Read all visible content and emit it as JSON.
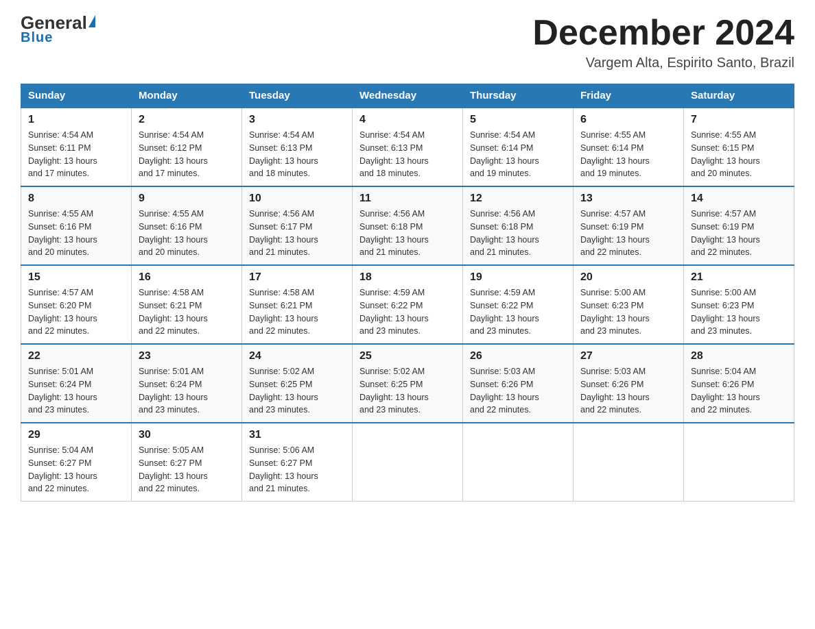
{
  "header": {
    "logo_general": "General",
    "logo_blue": "Blue",
    "month_title": "December 2024",
    "subtitle": "Vargem Alta, Espirito Santo, Brazil"
  },
  "days_of_week": [
    "Sunday",
    "Monday",
    "Tuesday",
    "Wednesday",
    "Thursday",
    "Friday",
    "Saturday"
  ],
  "weeks": [
    [
      {
        "day": "1",
        "sunrise": "4:54 AM",
        "sunset": "6:11 PM",
        "daylight": "13 hours and 17 minutes."
      },
      {
        "day": "2",
        "sunrise": "4:54 AM",
        "sunset": "6:12 PM",
        "daylight": "13 hours and 17 minutes."
      },
      {
        "day": "3",
        "sunrise": "4:54 AM",
        "sunset": "6:13 PM",
        "daylight": "13 hours and 18 minutes."
      },
      {
        "day": "4",
        "sunrise": "4:54 AM",
        "sunset": "6:13 PM",
        "daylight": "13 hours and 18 minutes."
      },
      {
        "day": "5",
        "sunrise": "4:54 AM",
        "sunset": "6:14 PM",
        "daylight": "13 hours and 19 minutes."
      },
      {
        "day": "6",
        "sunrise": "4:55 AM",
        "sunset": "6:14 PM",
        "daylight": "13 hours and 19 minutes."
      },
      {
        "day": "7",
        "sunrise": "4:55 AM",
        "sunset": "6:15 PM",
        "daylight": "13 hours and 20 minutes."
      }
    ],
    [
      {
        "day": "8",
        "sunrise": "4:55 AM",
        "sunset": "6:16 PM",
        "daylight": "13 hours and 20 minutes."
      },
      {
        "day": "9",
        "sunrise": "4:55 AM",
        "sunset": "6:16 PM",
        "daylight": "13 hours and 20 minutes."
      },
      {
        "day": "10",
        "sunrise": "4:56 AM",
        "sunset": "6:17 PM",
        "daylight": "13 hours and 21 minutes."
      },
      {
        "day": "11",
        "sunrise": "4:56 AM",
        "sunset": "6:18 PM",
        "daylight": "13 hours and 21 minutes."
      },
      {
        "day": "12",
        "sunrise": "4:56 AM",
        "sunset": "6:18 PM",
        "daylight": "13 hours and 21 minutes."
      },
      {
        "day": "13",
        "sunrise": "4:57 AM",
        "sunset": "6:19 PM",
        "daylight": "13 hours and 22 minutes."
      },
      {
        "day": "14",
        "sunrise": "4:57 AM",
        "sunset": "6:19 PM",
        "daylight": "13 hours and 22 minutes."
      }
    ],
    [
      {
        "day": "15",
        "sunrise": "4:57 AM",
        "sunset": "6:20 PM",
        "daylight": "13 hours and 22 minutes."
      },
      {
        "day": "16",
        "sunrise": "4:58 AM",
        "sunset": "6:21 PM",
        "daylight": "13 hours and 22 minutes."
      },
      {
        "day": "17",
        "sunrise": "4:58 AM",
        "sunset": "6:21 PM",
        "daylight": "13 hours and 22 minutes."
      },
      {
        "day": "18",
        "sunrise": "4:59 AM",
        "sunset": "6:22 PM",
        "daylight": "13 hours and 23 minutes."
      },
      {
        "day": "19",
        "sunrise": "4:59 AM",
        "sunset": "6:22 PM",
        "daylight": "13 hours and 23 minutes."
      },
      {
        "day": "20",
        "sunrise": "5:00 AM",
        "sunset": "6:23 PM",
        "daylight": "13 hours and 23 minutes."
      },
      {
        "day": "21",
        "sunrise": "5:00 AM",
        "sunset": "6:23 PM",
        "daylight": "13 hours and 23 minutes."
      }
    ],
    [
      {
        "day": "22",
        "sunrise": "5:01 AM",
        "sunset": "6:24 PM",
        "daylight": "13 hours and 23 minutes."
      },
      {
        "day": "23",
        "sunrise": "5:01 AM",
        "sunset": "6:24 PM",
        "daylight": "13 hours and 23 minutes."
      },
      {
        "day": "24",
        "sunrise": "5:02 AM",
        "sunset": "6:25 PM",
        "daylight": "13 hours and 23 minutes."
      },
      {
        "day": "25",
        "sunrise": "5:02 AM",
        "sunset": "6:25 PM",
        "daylight": "13 hours and 23 minutes."
      },
      {
        "day": "26",
        "sunrise": "5:03 AM",
        "sunset": "6:26 PM",
        "daylight": "13 hours and 22 minutes."
      },
      {
        "day": "27",
        "sunrise": "5:03 AM",
        "sunset": "6:26 PM",
        "daylight": "13 hours and 22 minutes."
      },
      {
        "day": "28",
        "sunrise": "5:04 AM",
        "sunset": "6:26 PM",
        "daylight": "13 hours and 22 minutes."
      }
    ],
    [
      {
        "day": "29",
        "sunrise": "5:04 AM",
        "sunset": "6:27 PM",
        "daylight": "13 hours and 22 minutes."
      },
      {
        "day": "30",
        "sunrise": "5:05 AM",
        "sunset": "6:27 PM",
        "daylight": "13 hours and 22 minutes."
      },
      {
        "day": "31",
        "sunrise": "5:06 AM",
        "sunset": "6:27 PM",
        "daylight": "13 hours and 21 minutes."
      },
      null,
      null,
      null,
      null
    ]
  ],
  "labels": {
    "sunrise": "Sunrise:",
    "sunset": "Sunset:",
    "daylight": "Daylight:"
  }
}
